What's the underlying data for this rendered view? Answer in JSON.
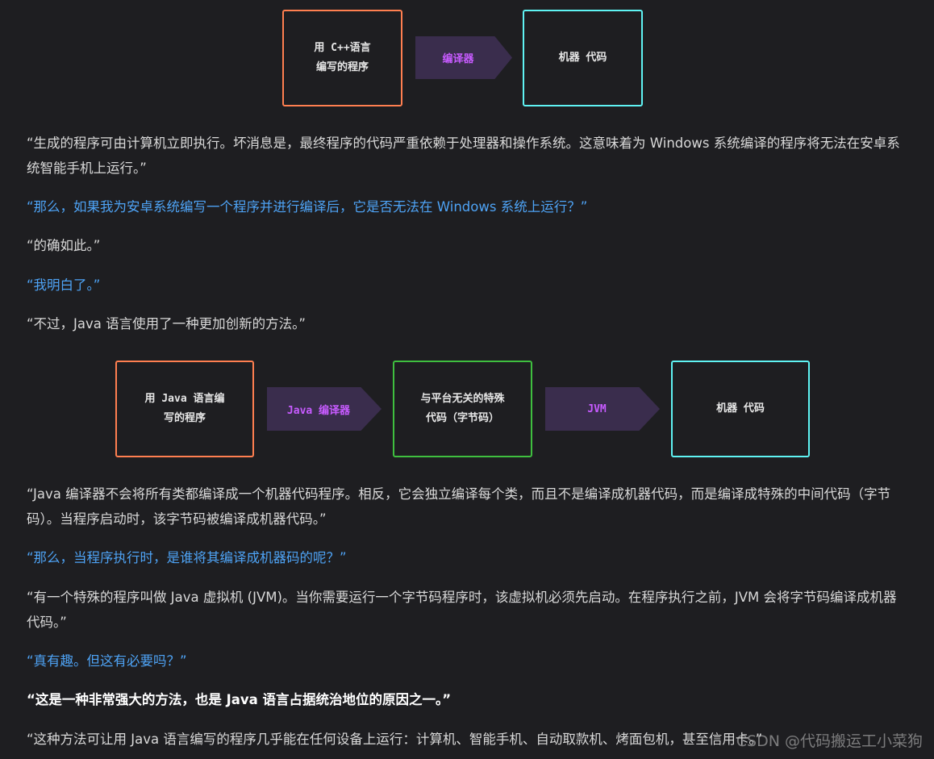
{
  "diagram1": {
    "box1": [
      "用 C++语言",
      "编写的程序"
    ],
    "arrow": "编译器",
    "box2": "机器 代码"
  },
  "diagram2": {
    "box1": [
      "用 Java 语言编",
      "写的程序"
    ],
    "arrow1": "Java 编译器",
    "box2": [
      "与平台无关的特殊",
      "代码（字节码）"
    ],
    "arrow2": "JVM",
    "box3": "机器 代码"
  },
  "paragraphs": [
    "“生成的程序可由计算机立即执行。坏消息是，最终程序的代码严重依赖于处理器和操作系统。这意味着为 Windows 系统编译的程序将无法在安卓系统智能手机上运行。”",
    "“那么，如果我为安卓系统编写一个程序并进行编译后，它是否无法在 Windows 系统上运行？”",
    "“的确如此。”",
    "“我明白了。”",
    "“不过，Java 语言使用了一种更加创新的方法。”",
    "“Java 编译器不会将所有类都编译成一个机器代码程序。相反，它会独立编译每个类，而且不是编译成机器代码，而是编译成特殊的中间代码（字节码）。当程序启动时，该字节码被编译成机器代码。”",
    "“那么，当程序执行时，是谁将其编译成机器码的呢？”",
    "“有一个特殊的程序叫做 Java 虚拟机 (JVM)。当你需要运行一个字节码程序时，该虚拟机必须先启动。在程序执行之前，JVM 会将字节码编译成机器代码。”",
    "“真有趣。但这有必要吗？”",
    "“这是一种非常强大的方法，也是 Java 语言占据统治地位的原因之一。”",
    "“这种方法可让用 Java 语言编写的程序几乎能在任何设备上运行：计算机、智能手机、自动取款机、烤面包机，甚至信用卡。”"
  ],
  "watermark": "CSDN @代码搬运工小菜狗"
}
